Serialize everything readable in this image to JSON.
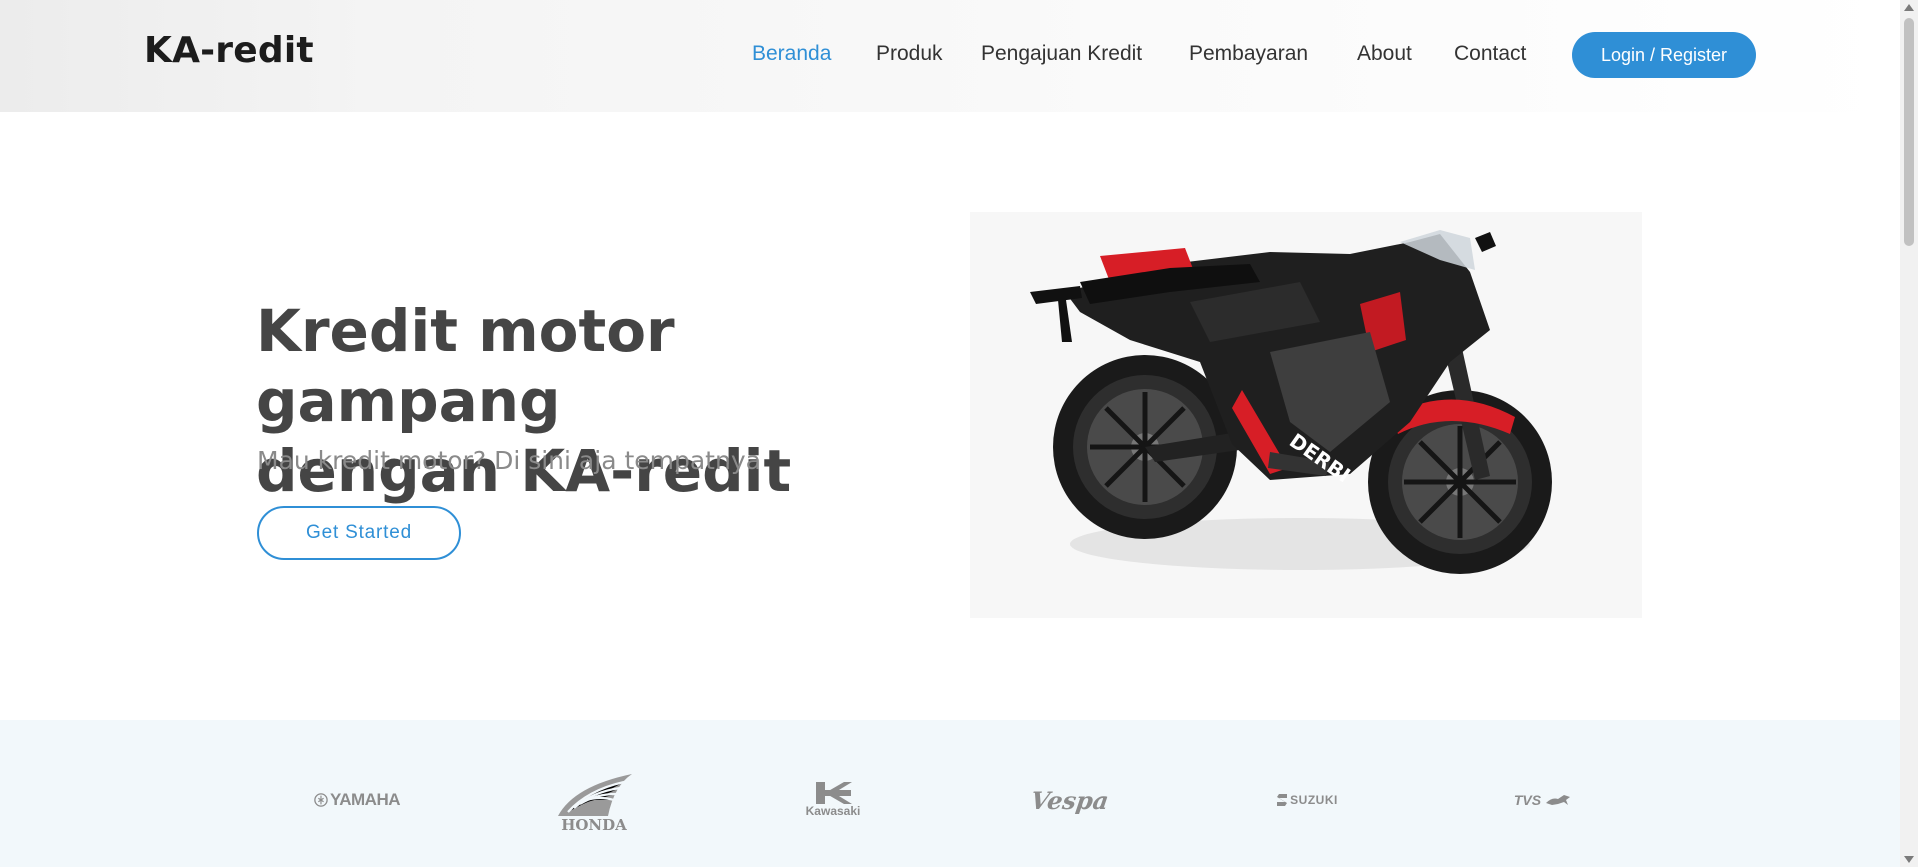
{
  "header": {
    "logo": "KA-redit",
    "nav": [
      {
        "label": "Beranda",
        "active": true
      },
      {
        "label": "Produk",
        "active": false
      },
      {
        "label": "Pengajuan Kredit",
        "active": false
      },
      {
        "label": "Pembayaran",
        "active": false
      },
      {
        "label": "About",
        "active": false
      },
      {
        "label": "Contact",
        "active": false
      }
    ],
    "login_label": "Login / Register"
  },
  "hero": {
    "title_line1": "Kredit motor gampang",
    "title_line2": "dengan KA-redit",
    "subtitle": "Mau kredit motor? Di sini aja tempatnya",
    "cta_label": "Get Started",
    "bike_brand_text": "DERBI"
  },
  "brands": [
    {
      "name": "YAMAHA",
      "icon": "yamaha-logo"
    },
    {
      "name": "HONDA",
      "icon": "honda-wing-logo"
    },
    {
      "name": "Kawasaki",
      "icon": "kawasaki-logo"
    },
    {
      "name": "Vespa",
      "icon": "vespa-logo"
    },
    {
      "name": "SUZUKI",
      "icon": "suzuki-logo"
    },
    {
      "name": "TVS",
      "icon": "tvs-logo"
    }
  ],
  "colors": {
    "accent": "#2f8fd6",
    "heading": "#454545",
    "subtitle": "#8a8a8a",
    "brand_strip_bg": "#f2f8fb"
  }
}
